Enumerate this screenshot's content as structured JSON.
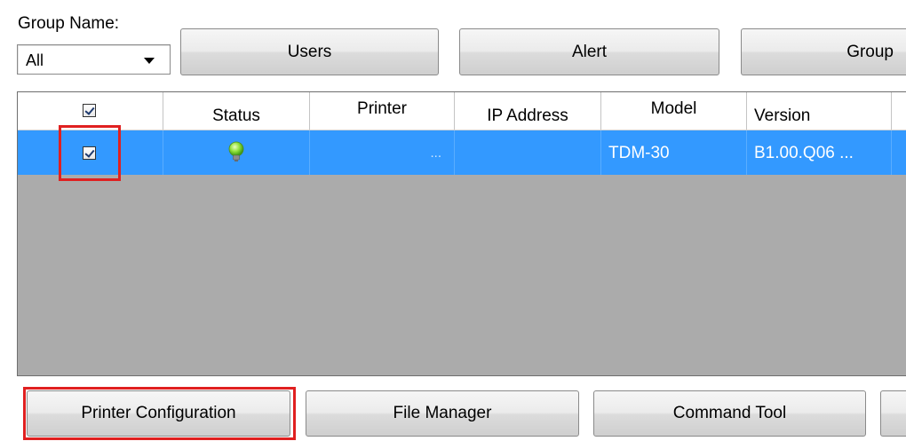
{
  "group": {
    "label": "Group Name:",
    "selected": "All"
  },
  "top_buttons": {
    "users": "Users",
    "alert": "Alert",
    "group": "Group"
  },
  "table": {
    "headers": {
      "status": "Status",
      "printer": "Printer",
      "ip": "IP Address",
      "model": "Model",
      "version": "Version"
    },
    "rows": [
      {
        "checked": true,
        "status_icon": "green-bulb-icon",
        "printer": "...",
        "ip": "",
        "model": "TDM-30",
        "version": "B1.00.Q06 ..."
      }
    ]
  },
  "bottom_buttons": {
    "printer_config": "Printer Configuration",
    "file_manager": "File Manager",
    "command_tool": "Command Tool"
  },
  "colors": {
    "selection": "#3399ff",
    "grid_background": "#ababab",
    "highlight": "#e02020"
  }
}
